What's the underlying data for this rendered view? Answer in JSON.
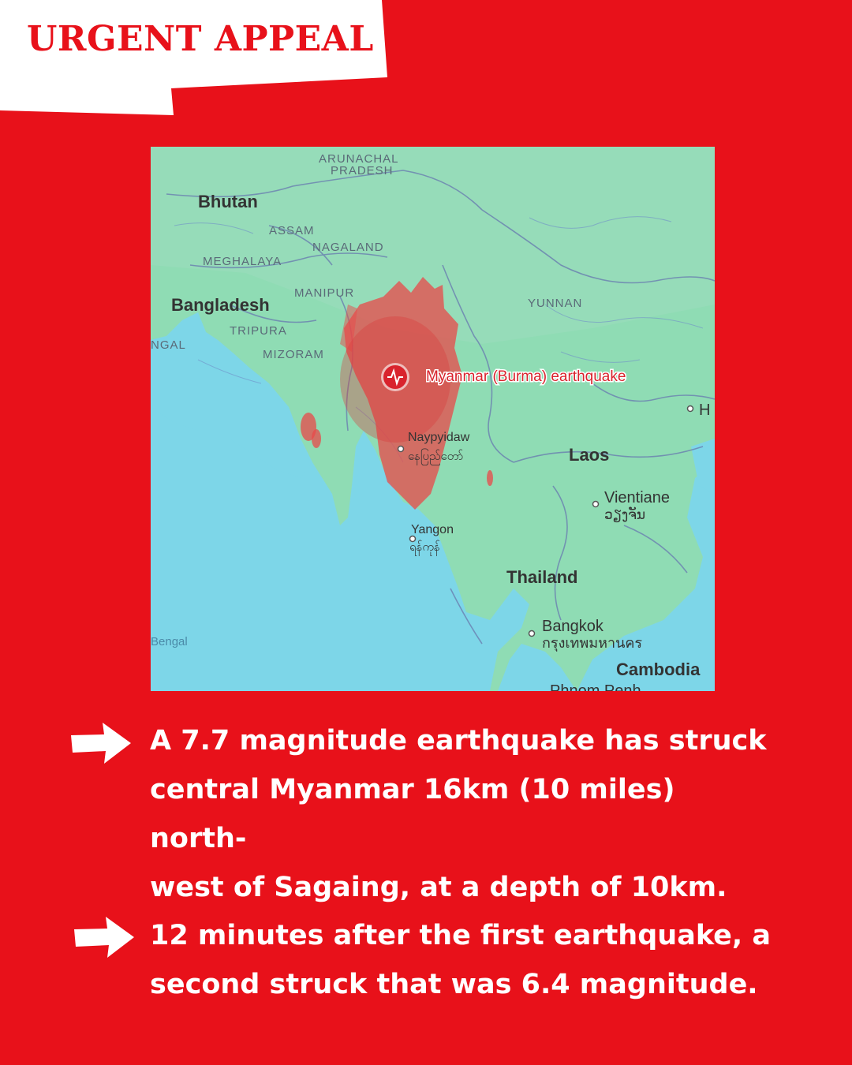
{
  "banner": {
    "title": "URGENT APPEAL"
  },
  "map": {
    "labels": {
      "arunachal": "ARUNACHAL",
      "pradesh": "PRADESH",
      "bhutan": "Bhutan",
      "assam": "ASSAM",
      "nagaland": "NAGALAND",
      "meghalaya": "MEGHALAYA",
      "manipur": "MANIPUR",
      "bangladesh": "Bangladesh",
      "tripura": "TRIPURA",
      "ngal": "NGAL",
      "mizoram": "MIZORAM",
      "yunnan": "YUNNAN",
      "quake": "Myanmar (Burma) earthquake",
      "h": "H",
      "naypyidaw": "Naypyidaw",
      "naypyidaw_local": "နေပြည်တော်",
      "laos": "Laos",
      "vientiane": "Vientiane",
      "vientiane_local": "ວຽງຈັນ",
      "yangon": "Yangon",
      "yangon_local": "ရန်ကုန်",
      "thailand": "Thailand",
      "bengal": "Bengal",
      "bangkok": "Bangkok",
      "bangkok_local": "กรุงเทพมหานคร",
      "cambodia": "Cambodia",
      "phnom_penh": "Phnom Penh"
    },
    "colors": {
      "land": "#8fdcb4",
      "water": "#7dd6e8",
      "quake_zone": "#e84a4a",
      "marker": "#d9232d"
    }
  },
  "bullets": [
    {
      "lines": [
        "A 7.7 magnitude earthquake has struck",
        "central Myanmar 16km (10 miles) north-",
        "west of Sagaing, at a depth of 10km."
      ]
    },
    {
      "lines": [
        "12 minutes after the first earthquake, a",
        "second struck that was 6.4 magnitude."
      ]
    }
  ],
  "colors": {
    "background": "#e8111a",
    "banner_bg": "#ffffff",
    "text": "#ffffff"
  }
}
